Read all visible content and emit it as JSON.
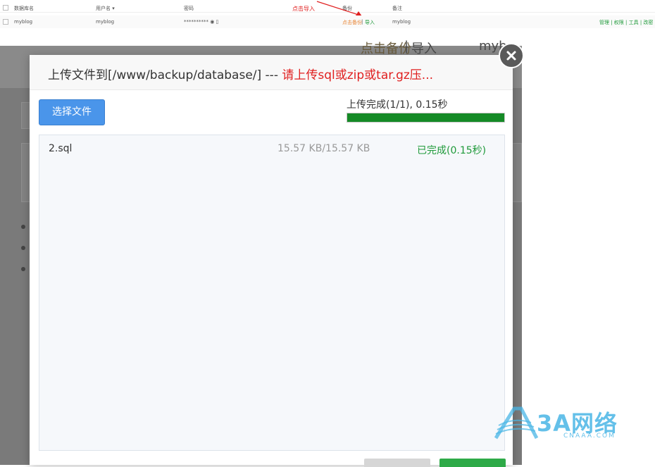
{
  "table_strip": {
    "headers": [
      "数据库名",
      "用户名 ▾",
      "密码",
      "备份",
      "备注"
    ],
    "annotation": "点击导入",
    "row": {
      "db_name": "myblog",
      "username": "myblog",
      "password": "********** ◉ ▯",
      "backup": "点击备份",
      "separator": "|",
      "import": "导入",
      "note": "myblog",
      "actions": "管理 | 权限 | 工具 | 改密"
    }
  },
  "background": {
    "ghost_backup": "点击备份",
    "ghost_separator": "|",
    "ghost_import": "导入",
    "ghost_name": "myb"
  },
  "dialog": {
    "title_path": "上传文件到[/www/backup/database/] --- ",
    "title_hint": "请上传sql或zip或tar.gz压...",
    "choose_button": "选择文件",
    "progress_text": "上传完成(1/1), 0.15秒",
    "progress_fraction": 1.0,
    "files": [
      {
        "name": "2.sql",
        "size": "15.57 KB/15.57 KB",
        "status": "已完成(0.15秒)"
      }
    ]
  },
  "watermark": {
    "brand": "3A网络",
    "domain": "CNAAA.COM"
  },
  "colors": {
    "primary_button": "#4a95ea",
    "progress_fill": "#158a26",
    "success_text": "#1f9a3a",
    "warning_text": "#e02020"
  }
}
